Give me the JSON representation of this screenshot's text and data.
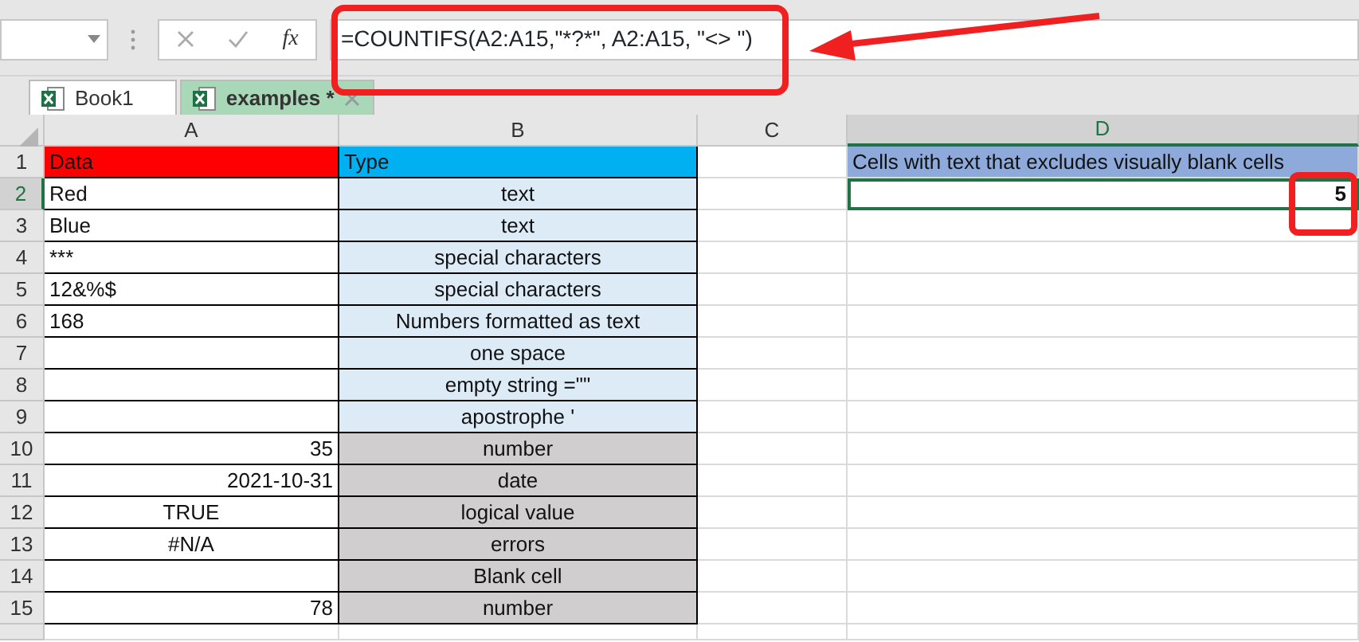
{
  "formula_bar": {
    "fx_label": "fx",
    "formula": "=COUNTIFS(A2:A15,\"*?*\", A2:A15, \"<> \")"
  },
  "tabs": [
    {
      "label": "Book1",
      "selected": false
    },
    {
      "label": "examples *",
      "selected": true
    }
  ],
  "columns": [
    {
      "label": "A",
      "selected": false
    },
    {
      "label": "B",
      "selected": false
    },
    {
      "label": "C",
      "selected": false
    },
    {
      "label": "D",
      "selected": true
    }
  ],
  "rows": [
    {
      "number": "1",
      "kind": "header",
      "selected": false,
      "a": {
        "text": "Data",
        "kind": "text"
      },
      "b": "Type",
      "d": "Cells with text that excludes visually blank cells"
    },
    {
      "number": "2",
      "kind": "text_type",
      "selected": true,
      "a": {
        "text": "Red",
        "kind": "text"
      },
      "b": "text",
      "d": "5"
    },
    {
      "number": "3",
      "kind": "text_type",
      "selected": false,
      "a": {
        "text": "Blue",
        "kind": "text"
      },
      "b": "text"
    },
    {
      "number": "4",
      "kind": "text_type",
      "selected": false,
      "a": {
        "text": "***",
        "kind": "text"
      },
      "b": "special characters"
    },
    {
      "number": "5",
      "kind": "text_type",
      "selected": false,
      "a": {
        "text": "12&%$",
        "kind": "text"
      },
      "b": "special characters"
    },
    {
      "number": "6",
      "kind": "text_type",
      "selected": false,
      "a": {
        "text": "168",
        "kind": "text"
      },
      "b": "Numbers formatted as text"
    },
    {
      "number": "7",
      "kind": "text_type",
      "selected": false,
      "b": "one space"
    },
    {
      "number": "8",
      "kind": "text_type",
      "selected": false,
      "b": "empty string =\"\""
    },
    {
      "number": "9",
      "kind": "text_type",
      "selected": false,
      "b": "apostrophe '"
    },
    {
      "number": "10",
      "kind": "other_type",
      "selected": false,
      "a": {
        "text": "35",
        "kind": "number"
      },
      "b": "number"
    },
    {
      "number": "11",
      "kind": "other_type",
      "selected": false,
      "a": {
        "text": "2021-10-31",
        "kind": "number"
      },
      "b": "date"
    },
    {
      "number": "12",
      "kind": "other_type",
      "selected": false,
      "a": {
        "text": "TRUE",
        "kind": "logical"
      },
      "b": "logical value"
    },
    {
      "number": "13",
      "kind": "other_type",
      "selected": false,
      "a": {
        "text": "#N/A",
        "kind": "logical"
      },
      "b": "errors"
    },
    {
      "number": "14",
      "kind": "other_type",
      "selected": false,
      "b": "Blank cell"
    },
    {
      "number": "15",
      "kind": "other_type",
      "selected": false,
      "a": {
        "text": "78",
        "kind": "number"
      },
      "b": "number"
    }
  ]
}
